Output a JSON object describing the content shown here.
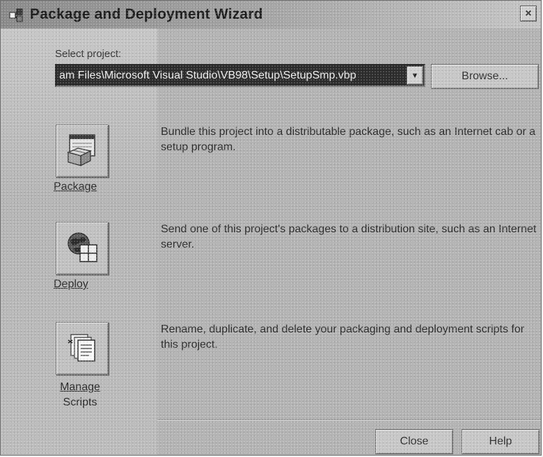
{
  "window": {
    "title": "Package and Deployment Wizard",
    "close_symbol": "×"
  },
  "project": {
    "label": "Select project:",
    "path": "am Files\\Microsoft Visual Studio\\VB98\\Setup\\SetupSmp.vbp",
    "dropdown_symbol": "▼",
    "browse_label": "Browse..."
  },
  "actions": [
    {
      "label": "Package",
      "icon": "package-icon",
      "description": "Bundle this project into a distributable package, such as an Internet cab or a setup program."
    },
    {
      "label": "Deploy",
      "icon": "deploy-globe-icon",
      "description": "Send one of this project's packages to a distribution site, such as an Internet server."
    },
    {
      "label_line1": "Manage",
      "label_line2": "Scripts",
      "icon": "manage-scripts-icon",
      "description": "Rename, duplicate, and delete your packaging and deployment scripts for this project."
    }
  ],
  "footer": {
    "close_label": "Close",
    "help_label": "Help"
  }
}
